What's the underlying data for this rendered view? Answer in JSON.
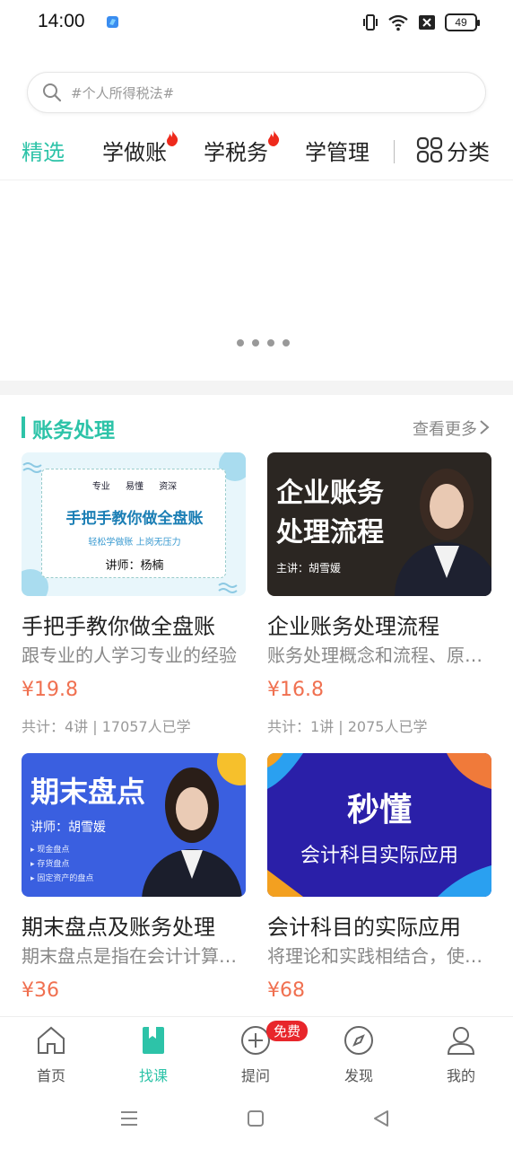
{
  "status_bar": {
    "time": "14:00",
    "battery": "49"
  },
  "search": {
    "placeholder": "#个人所得税法#"
  },
  "tabs": [
    {
      "label": "精选",
      "active": true
    },
    {
      "label": "学做账",
      "hot": true
    },
    {
      "label": "学税务",
      "hot": true
    },
    {
      "label": "学管理"
    }
  ],
  "category_label": "分类",
  "section": {
    "title": "账务处理",
    "more": "查看更多"
  },
  "courses": [
    {
      "title": "手把手教你做全盘账",
      "desc": "跟专业的人学习专业的经验",
      "price": "¥19.8",
      "meta": "共计：4讲 | 17057人已学",
      "thumb": {
        "tags": [
          "专业",
          "易懂",
          "资深"
        ],
        "headline": "手把手教你做全盘账",
        "sub": "轻松学做账   上岗无压力",
        "teacher": "讲师：杨楠"
      }
    },
    {
      "title": "企业账务处理流程",
      "desc": "账务处理概念和流程、原则…",
      "price": "¥16.8",
      "meta": "共计：1讲 | 2075人已学",
      "thumb": {
        "headline_1": "企业账务",
        "headline_2": "处理流程",
        "teacher": "主讲：胡雪媛"
      }
    },
    {
      "title": "期末盘点及账务处理",
      "desc": "期末盘点是指在会计计算…",
      "price": "¥36",
      "meta": "",
      "thumb": {
        "headline": "期末盘点",
        "teacher": "讲师：胡雪媛",
        "bullets": [
          "现金盘点",
          "存货盘点",
          "固定资产的盘点"
        ]
      }
    },
    {
      "title": "会计科目的实际应用",
      "desc": "将理论和实践相结合，使…",
      "price": "¥68",
      "meta": "",
      "thumb": {
        "headline": "秒懂",
        "sub": "会计科目实际应用"
      }
    }
  ],
  "bottom_nav": [
    {
      "label": "首页",
      "icon": "home-icon"
    },
    {
      "label": "找课",
      "icon": "bookmark-book-icon",
      "active": true
    },
    {
      "label": "提问",
      "icon": "plus-circle-icon",
      "badge": "免费"
    },
    {
      "label": "发现",
      "icon": "compass-icon"
    },
    {
      "label": "我的",
      "icon": "user-icon"
    }
  ],
  "colors": {
    "accent": "#2dc3a8",
    "price": "#f07050",
    "badge": "#e8262b"
  }
}
